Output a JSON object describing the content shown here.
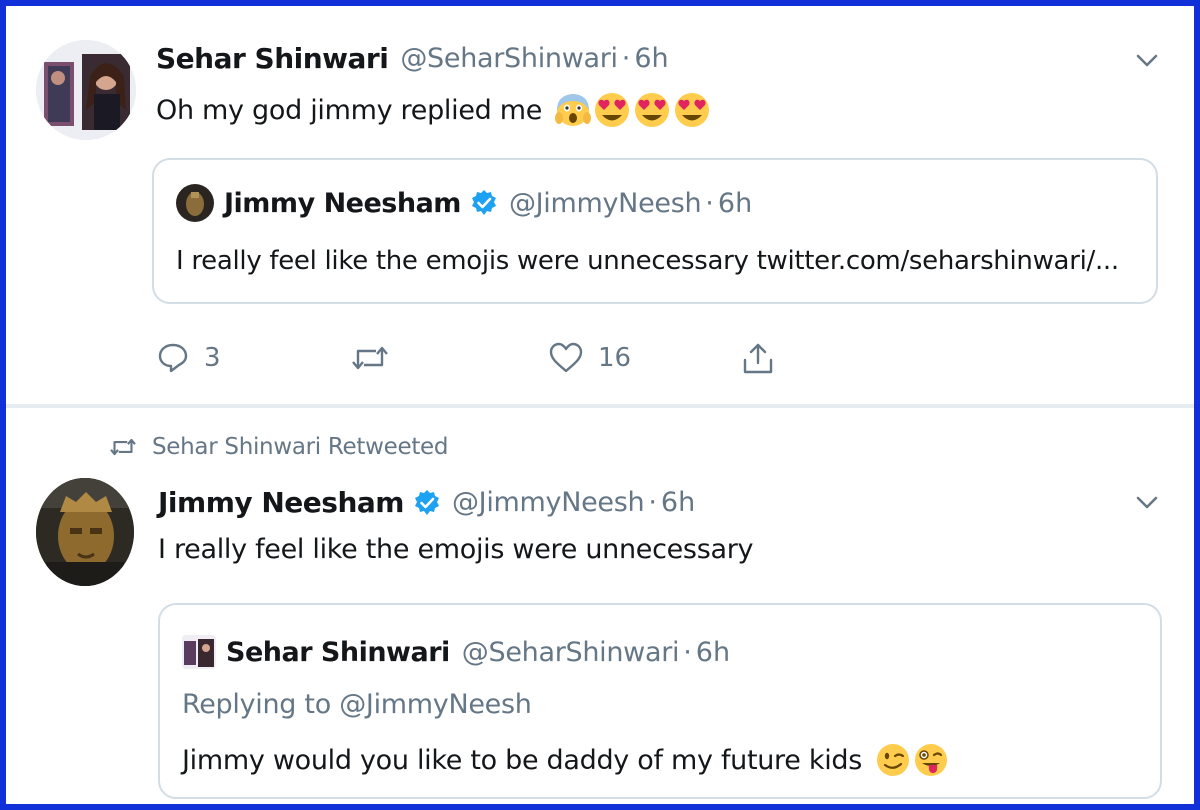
{
  "tweet1": {
    "author_name": "Sehar Shinwari",
    "author_handle": "@SeharShinwari",
    "separator": "·",
    "time": "6h",
    "text": "Oh my god jimmy replied me",
    "emojis": [
      "scream-emoji",
      "heart-eyes-emoji",
      "heart-eyes-emoji",
      "heart-eyes-emoji"
    ],
    "quote": {
      "author_name": "Jimmy Neesham",
      "author_handle": "@JimmyNeesh",
      "time": "6h",
      "text": "I really feel like the emojis were unnecessary twitter.com/seharshinwari/..."
    },
    "actions": {
      "reply_count": "3",
      "retweet_count": "",
      "like_count": "16"
    }
  },
  "tweet2": {
    "retweet_label": "Sehar Shinwari Retweeted",
    "author_name": "Jimmy Neesham",
    "author_handle": "@JimmyNeesh",
    "separator": "·",
    "time": "6h",
    "text": "I really feel like the emojis were unnecessary",
    "quote": {
      "author_name": "Sehar Shinwari",
      "author_handle": "@SeharShinwari",
      "time": "6h",
      "replying_to": "Replying to @JimmyNeesh",
      "text": "Jimmy would you like to be daddy of my future kids",
      "emojis": [
        "wink-emoji",
        "tongue-wink-emoji"
      ]
    }
  },
  "colors": {
    "frame_border": "#1230d8",
    "text_primary": "#14171a",
    "text_secondary": "#657786",
    "verified_blue": "#1da1f2",
    "divider": "#e6ecf0"
  }
}
